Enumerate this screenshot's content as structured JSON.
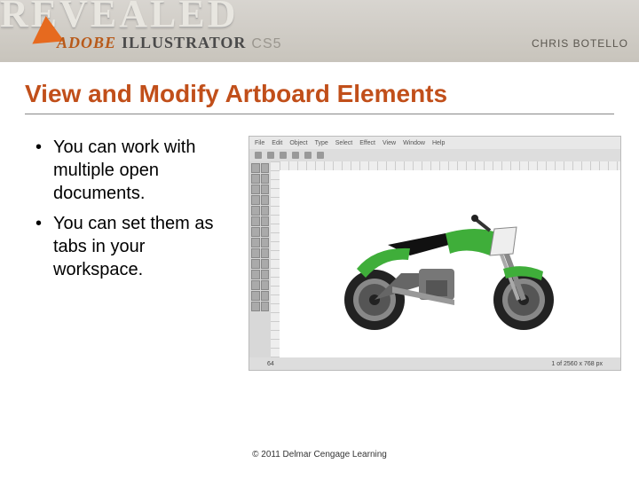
{
  "banner": {
    "revealed": "REVEALED",
    "adobe": "ADOBE",
    "illustrator": "ILLUSTRATOR",
    "cs5": "CS5",
    "author": "CHRIS BOTELLO"
  },
  "title": "View and Modify Artboard Elements",
  "bullets": [
    "You can work with multiple open documents.",
    "You can set them as tabs in your workspace."
  ],
  "screenshot": {
    "menu": [
      "File",
      "Edit",
      "Object",
      "Type",
      "Select",
      "Effect",
      "View",
      "Window",
      "Help"
    ],
    "zoom": "64",
    "status": "1 of 2560 x 768 px"
  },
  "footer": "© 2011 Delmar Cengage Learning"
}
